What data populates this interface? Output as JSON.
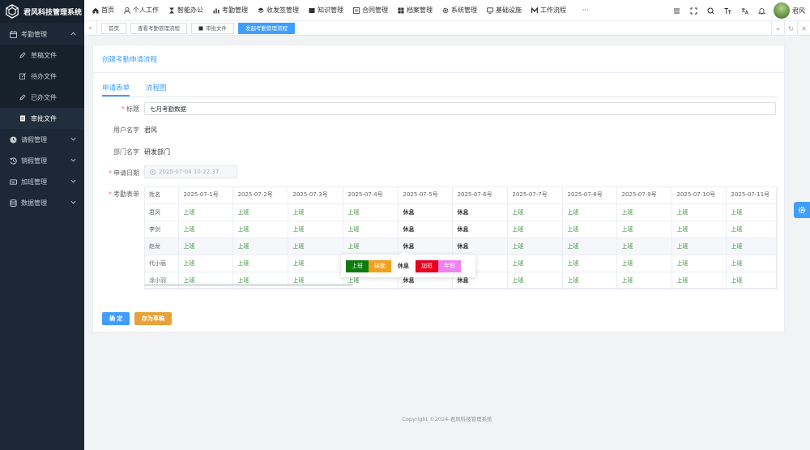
{
  "app": {
    "title": "君风科技管理系统"
  },
  "sidebar": {
    "groups": [
      {
        "label": "考勤管理",
        "icon": "calendar-icon",
        "expanded": true
      },
      {
        "label": "请假管理",
        "icon": "clock-icon"
      },
      {
        "label": "销假管理",
        "icon": "history-icon"
      },
      {
        "label": "加班管理",
        "icon": "keyboard-icon"
      },
      {
        "label": "数据管理",
        "icon": "database-icon"
      }
    ],
    "sub_items": [
      {
        "label": "草稿文件",
        "icon": "edit-icon"
      },
      {
        "label": "待办文件",
        "icon": "edit-square-icon"
      },
      {
        "label": "已办文件",
        "icon": "edit-icon"
      },
      {
        "label": "审批文件",
        "icon": "document-icon"
      }
    ]
  },
  "topnav": {
    "items": [
      "首页",
      "个人工作",
      "智能办公",
      "考勤管理",
      "收发签管理",
      "知识管理",
      "合同管理",
      "档案管理",
      "系统管理",
      "基础设施",
      "工作流程",
      "···"
    ]
  },
  "user": {
    "name": "君风"
  },
  "tabs": {
    "items": [
      "首页",
      "查看考勤管理流程",
      "审批文件",
      "发起考勤管理流程"
    ],
    "active_index": 3
  },
  "page": {
    "title": "创建考勤申请流程",
    "inner_tabs": [
      "申请表单",
      "流程图"
    ],
    "form": {
      "title_label": "标题",
      "title_value": "七月考勤数据",
      "user_label": "用户名字",
      "user_value": "君风",
      "dept_label": "部门名字",
      "dept_value": "研发部门",
      "date_label": "申请日期",
      "date_value": "2025-07-04 10:22:37",
      "table_label": "考勤表单"
    },
    "table": {
      "headers": [
        "姓名",
        "2025-07-1号",
        "2025-07-2号",
        "2025-07-3号",
        "2025-07-4号",
        "2025-07-5号",
        "2025-07-6号",
        "2025-07-7号",
        "2025-07-8号",
        "2025-07-9号",
        "2025-07-10号",
        "2025-07-11号"
      ],
      "rows": [
        {
          "name": "君风",
          "cells": [
            "上班",
            "上班",
            "上班",
            "上班",
            "休息",
            "休息",
            "上班",
            "上班",
            "上班",
            "上班",
            "上班"
          ]
        },
        {
          "name": "李剑",
          "cells": [
            "上班",
            "上班",
            "上班",
            "上班",
            "休息",
            "休息",
            "上班",
            "上班",
            "上班",
            "上班",
            "上班"
          ]
        },
        {
          "name": "赵龙",
          "cells": [
            "上班",
            "上班",
            "上班",
            "上班",
            "休息",
            "休息",
            "上班",
            "上班",
            "上班",
            "上班",
            "上班"
          ]
        },
        {
          "name": "代小丽",
          "cells": [
            "上班",
            "上班",
            "上班",
            "",
            "",
            "",
            "上班",
            "上班",
            "上班",
            "上班",
            "上班"
          ]
        },
        {
          "name": "涂小羽",
          "cells": [
            "上班",
            "上班",
            "上班",
            "上班",
            "休息",
            "休息",
            "上班",
            "上班",
            "上班",
            "上班",
            "上班"
          ]
        }
      ]
    },
    "popover": {
      "options": [
        {
          "label": "上班",
          "color": "#0f7b0f"
        },
        {
          "label": "缺勤",
          "color": "#f0a020"
        },
        {
          "label": "休息",
          "color": ""
        },
        {
          "label": "加班",
          "color": "#e8001c"
        },
        {
          "label": "年假",
          "color": "#ee82ee"
        }
      ]
    },
    "buttons": {
      "ok": "确 定",
      "draft": "存为草稿"
    }
  },
  "footer": "Copyright ©2024-君风科技管理系统",
  "colors": {
    "primary": "#409eff",
    "sidebar": "#1c2836",
    "work": "#2e8b2e",
    "warning": "#e6a23c"
  }
}
